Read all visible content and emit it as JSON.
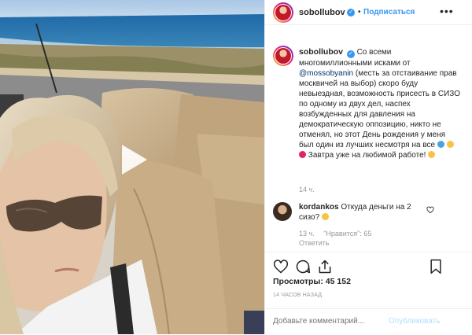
{
  "post": {
    "username": "sobollubov",
    "follow_label": "Подписаться",
    "separator": "•",
    "more_label": "•••",
    "caption_parts": {
      "p1": "Со всеми многомиллионными исками от",
      "mention": "@mossobyanin",
      "p2": "(месть за отстаивание прав москвичей на выбор) скоро буду невыездная, возможность присесть в СИЗО по одному из двух дел, наспех возбужденных для давления на демократическую оппозицию, никто не отменял, но этот День рождения у меня был один из лучших несмотря на все",
      "p3": "Завтра уже на любимой работе!"
    },
    "caption_time": "14 ч.",
    "comment": {
      "username": "kordankos",
      "text": "Откуда деньги на 2 сизо?",
      "time": "13 ч.",
      "likes": "\"Нравится\": 65",
      "reply_label": "Ответить"
    },
    "likes_text": "Просмотры: 45 152",
    "timestamp_text": "14 ЧАСОВ НАЗАД",
    "add_comment_placeholder": "Добавьте комментарий...",
    "publish_label": "Опубликовать"
  },
  "icons": {
    "verified": "verified-badge-icon",
    "play": "play-icon",
    "heart": "heart-icon",
    "comment": "comment-icon",
    "share": "share-icon",
    "save": "bookmark-icon"
  },
  "colors": {
    "link_blue": "#3897f0",
    "mention": "#003569",
    "muted": "#999999"
  }
}
